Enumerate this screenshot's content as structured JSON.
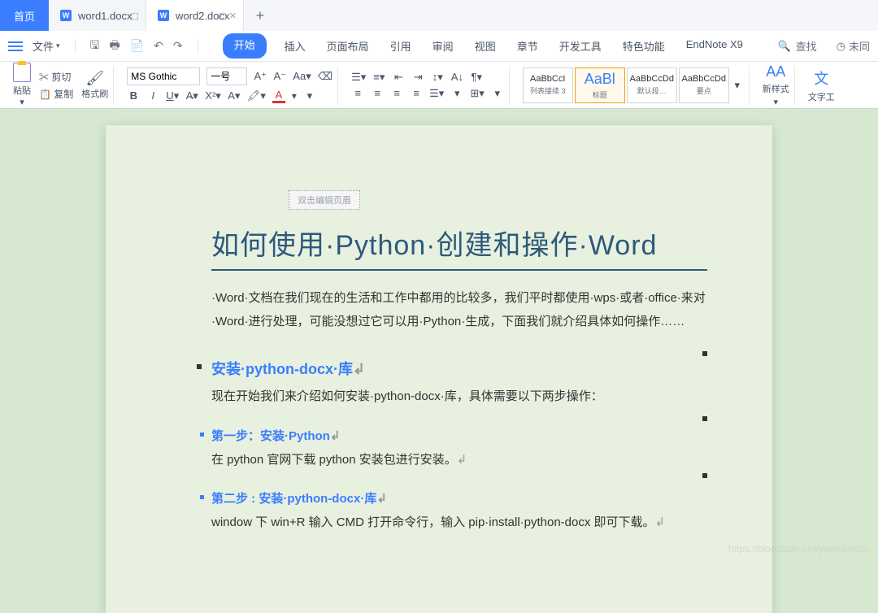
{
  "tabs": {
    "home": "首页",
    "doc1": "word1.docx",
    "doc2": "word2.docx",
    "plus": "+"
  },
  "menu": {
    "file": "文件",
    "tabs": [
      "开始",
      "插入",
      "页面布局",
      "引用",
      "审阅",
      "视图",
      "章节",
      "开发工具",
      "特色功能",
      "EndNote X9"
    ],
    "search": "查找",
    "unsaved": "未同"
  },
  "ribbon": {
    "paste": "粘贴",
    "cut": "剪切",
    "copy": "复制",
    "format": "格式刷",
    "font": "MS Gothic",
    "size": "一号",
    "styles": [
      {
        "prev": "AaBbCcI",
        "name": "列表接续 3"
      },
      {
        "prev": "AaBl",
        "name": "标题"
      },
      {
        "prev": "AaBbCcDd",
        "name": "默认段…"
      },
      {
        "prev": "AaBbCcDd",
        "name": "要点"
      }
    ],
    "newstyle": "新样式",
    "texttools": "文字工"
  },
  "doc": {
    "headerHint": "双击编辑页眉",
    "title": "如何使用·Python·创建和操作·Word",
    "intro": "·Word·文档在我们现在的生活和工作中都用的比较多，我们平时都使用·wps·或者·office·来对·Word·进行处理，可能没想过它可以用·Python·生成，下面我们就介绍具体如何操作……",
    "h2": "安装·python-docx·库",
    "p2": "现在开始我们来介绍如何安装·python-docx·库，具体需要以下两步操作：",
    "h3a": "第一步：安装·Python",
    "p3a": "在 python 官网下载 python 安装包进行安装。",
    "h3b": "第二步 : 安装·python-docx·库",
    "p3b": "window 下 win+R 输入 CMD 打开命令行，输入 pip·install·python-docx 即可下载。"
  },
  "watermark": "https://blog.csdn.net/ywsydwsbn"
}
